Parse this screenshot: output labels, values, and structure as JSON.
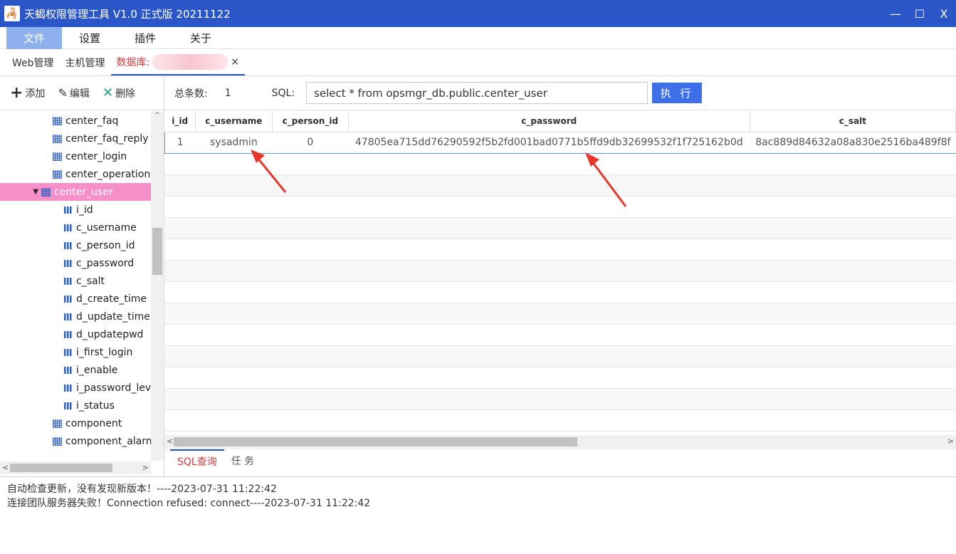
{
  "window": {
    "title": "天蝎权限管理工具 V1.0 正式版 20211122",
    "controls": {
      "minimize": "—",
      "maximize": "☐",
      "close": "X"
    }
  },
  "menu": [
    "文件",
    "设置",
    "插件",
    "关于"
  ],
  "tabs": {
    "web": "Web管理",
    "host": "主机管理",
    "db": "数据库:",
    "close": "×"
  },
  "left_toolbar": {
    "add": "添加",
    "edit": "编辑",
    "delete": "删除"
  },
  "tree": {
    "tables_before": [
      "center_faq",
      "center_faq_reply",
      "center_login",
      "center_operation"
    ],
    "selected": "center_user",
    "columns": [
      "i_id",
      "c_username",
      "c_person_id",
      "c_password",
      "c_salt",
      "d_create_time",
      "d_update_time",
      "d_updatepwd",
      "i_first_login",
      "i_enable",
      "i_password_level",
      "i_status"
    ],
    "tables_after": [
      "component",
      "component_alarm"
    ]
  },
  "query": {
    "count_label": "总条数:",
    "count": "1",
    "sql_label": "SQL:",
    "sql": "select * from opsmgr_db.public.center_user",
    "execute": "执 行"
  },
  "result": {
    "headers": [
      "i_id",
      "c_username",
      "c_person_id",
      "c_password",
      "c_salt"
    ],
    "rows": [
      [
        "1",
        "sysadmin",
        "0",
        "47805ea715dd76290592f5b2fd001bad0771b5ffd9db32699532f1f725162b0d",
        "8ac889d84632a08a830e2516ba489f8f"
      ]
    ]
  },
  "bottom_tabs": {
    "sql_query": "SQL查询",
    "task": "任 务"
  },
  "log": [
    "自动检查更新，没有发现新版本！----2023-07-31 11:22:42",
    "连接团队服务器失败！Connection refused: connect----2023-07-31 11:22:42"
  ],
  "colors": {
    "titlebar": "#2b56c8",
    "selected_node": "#f78fc9",
    "execute_button": "#3d6fe8",
    "annotation": "#e8362d"
  }
}
